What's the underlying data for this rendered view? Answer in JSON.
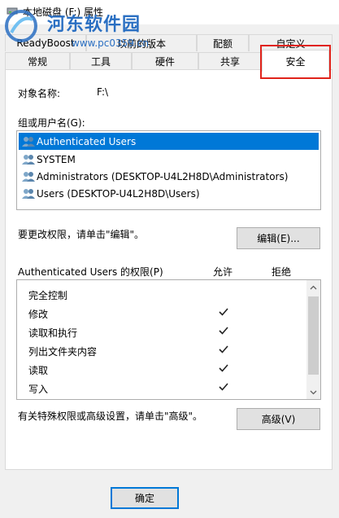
{
  "window": {
    "title": "本地磁盘 (F:) 属性"
  },
  "watermark": {
    "title": "河东软件园",
    "url": "www.pc0359.cn"
  },
  "tabs": {
    "row1": [
      "ReadyBoost",
      "以前的版本",
      "配额",
      "自定义"
    ],
    "row2": [
      "常规",
      "工具",
      "硬件",
      "共享",
      "安全"
    ],
    "selected": "安全"
  },
  "object": {
    "label": "对象名称:",
    "value": "F:\\"
  },
  "users": {
    "label": "组或用户名(G):",
    "items": [
      "Authenticated Users",
      "SYSTEM",
      "Administrators (DESKTOP-U4L2H8D\\Administrators)",
      "Users (DESKTOP-U4L2H8D\\Users)"
    ],
    "selected_index": 0
  },
  "edit": {
    "hint": "要更改权限，请单击\"编辑\"。",
    "button": "编辑(E)..."
  },
  "permissions": {
    "label": "Authenticated Users 的权限(P)",
    "allow_header": "允许",
    "deny_header": "拒绝",
    "rows": [
      {
        "name": "完全控制",
        "allow": false,
        "deny": false
      },
      {
        "name": "修改",
        "allow": true,
        "deny": false
      },
      {
        "name": "读取和执行",
        "allow": true,
        "deny": false
      },
      {
        "name": "列出文件夹内容",
        "allow": true,
        "deny": false
      },
      {
        "name": "读取",
        "allow": true,
        "deny": false
      },
      {
        "name": "写入",
        "allow": true,
        "deny": false
      }
    ]
  },
  "advanced": {
    "hint": "有关特殊权限或高级设置，请单击\"高级\"。",
    "button": "高级(V)"
  },
  "footer": {
    "ok_button": "确定"
  },
  "colors": {
    "selection": "#0078d7",
    "highlight_box": "#e0231b",
    "watermark": "#2a6fc2"
  }
}
